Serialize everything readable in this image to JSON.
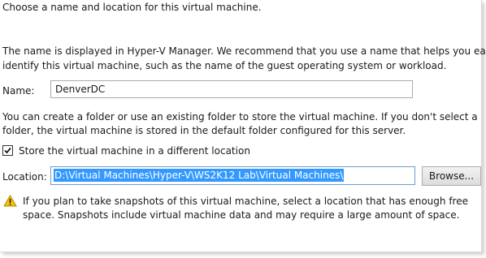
{
  "heading": "Choose a name and location for this virtual machine.",
  "description": [
    "The name is displayed in Hyper-V Manager. We recommend that you use a name that helps you easily",
    "identify this virtual machine, such as the name of the guest operating system or workload."
  ],
  "name_field": {
    "label": "Name:",
    "value": "DenverDC"
  },
  "folder_info": [
    "You can create a folder or use an existing folder to store the virtual machine. If you don't select a",
    "folder, the virtual machine is stored in the default folder configured for this server."
  ],
  "store_checkbox": {
    "label": "Store the virtual machine in a different location",
    "checked": true
  },
  "location_field": {
    "label": "Location:",
    "value": "D:\\Virtual Machines\\Hyper-V\\WS2K12 Lab\\Virtual Machines\\",
    "browse_label": "Browse..."
  },
  "warning": {
    "icon": "warning-icon",
    "lines": [
      "If you plan to take snapshots of this virtual machine, select a location that has enough free",
      "space. Snapshots include virtual machine data and may require a large amount of space."
    ]
  },
  "colors": {
    "selection": "#3399ff",
    "warning_fill": "#f5c400",
    "focus_border": "#6b9bd1"
  }
}
